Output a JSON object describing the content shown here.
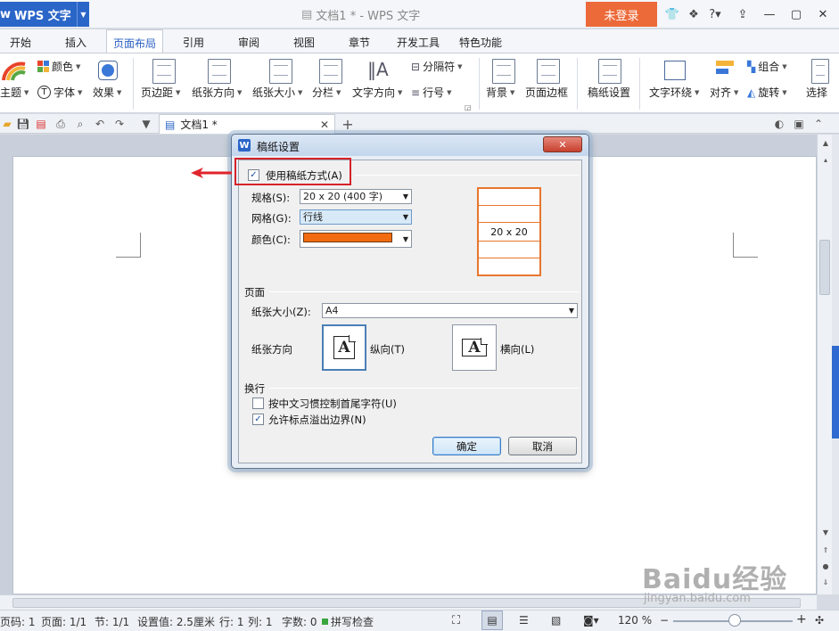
{
  "app": {
    "name": "WPS 文字",
    "window_title": "文档1 * - WPS 文字",
    "login_label": "未登录"
  },
  "tabs": [
    "开始",
    "插入",
    "页面布局",
    "引用",
    "审阅",
    "视图",
    "章节",
    "开发工具",
    "特色功能"
  ],
  "active_tab": "页面布局",
  "ribbon": {
    "color": "颜色",
    "theme": "主题",
    "font": "字体",
    "effect": "效果",
    "margin": "页边距",
    "orientation": "纸张方向",
    "size": "纸张大小",
    "columns": "分栏",
    "text_direction": "文字方向",
    "separator": "分隔符",
    "line_number": "行号",
    "background": "背景",
    "page_border": "页面边框",
    "grid_paper": "稿纸设置",
    "wrap": "文字环绕",
    "align": "对齐",
    "group": "组合",
    "rotate": "旋转",
    "select": "选择"
  },
  "document_tab": "文档1 *",
  "dialog": {
    "title": "稿纸设置",
    "close": "✕",
    "use_grid": "使用稿纸方式(A)",
    "spec_label": "规格(S):",
    "spec_value": "20 x 20 (400 字)",
    "grid_label": "网格(G):",
    "grid_value": "行线",
    "color_label": "颜色(C):",
    "color_value": "#f26b10",
    "preview_text": "20 x 20",
    "page_section": "页面",
    "paper_size_label": "纸张大小(Z):",
    "paper_size_value": "A4",
    "orientation_label": "纸张方向",
    "portrait": "纵向(T)",
    "landscape": "横向(L)",
    "wrap_section": "换行",
    "opt1": "按中文习惯控制首尾字符(U)",
    "opt1_checked": false,
    "opt2": "允许标点溢出边界(N)",
    "opt2_checked": true,
    "ok": "确定",
    "cancel": "取消"
  },
  "status": {
    "page_code": "页码: 1",
    "page": "页面: 1/1",
    "section": "节: 1/1",
    "setting": "设置值: 2.5厘米",
    "row": "行: 1",
    "col": "列: 1",
    "word_count": "字数: 0",
    "spell": "拼写检查",
    "zoom": "120 %"
  },
  "watermark": {
    "brand": "Baidu经验",
    "url": "jingyan.baidu.com"
  }
}
